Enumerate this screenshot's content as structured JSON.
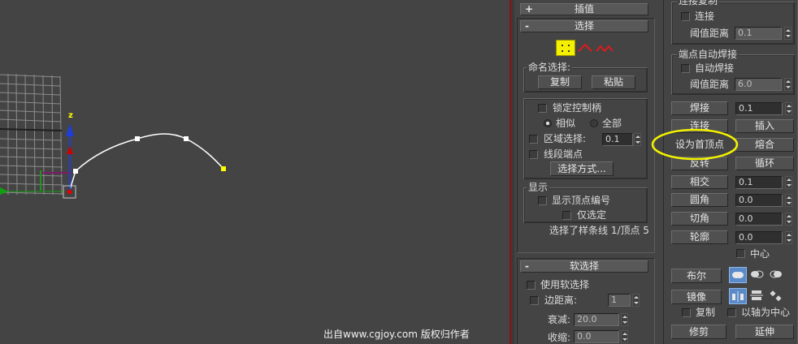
{
  "watermark": "出自www.cgjoy.com 版权归作者",
  "viewport": {
    "axis_z_label": "z"
  },
  "colors": {
    "viewport_bg": "#444444",
    "spline": "#ffffff",
    "vertex_selected": "#ffff00",
    "highlight_ellipse": "#f3f200",
    "accent_red": "#e00000",
    "active_icon": "#5a8ac8"
  },
  "interpolation": {
    "toggle": "+",
    "title": "插值"
  },
  "selection": {
    "toggle": "-",
    "title": "选择",
    "level_icons": [
      "vertex-level-icon",
      "segment-level-icon",
      "spline-level-icon"
    ],
    "named_group_label": "命名选择:",
    "copy_label": "复制",
    "paste_label": "粘贴",
    "lock_handles_label": "锁定控制柄",
    "similar_label": "相似",
    "all_label": "全部",
    "area_select_label": "区域选择:",
    "area_select_value": "0.1",
    "segment_end_label": "线段端点",
    "select_by_label": "选择方式...",
    "display_group_label": "显示",
    "show_vertex_numbers_label": "显示顶点编号",
    "selected_only_label": "仅选定",
    "status": "选择了样条线 1/顶点 5"
  },
  "soft_selection": {
    "toggle": "-",
    "title": "软选择",
    "use_soft_label": "使用软选择",
    "edge_distance_label": "边距离:",
    "edge_distance_value": "1",
    "falloff_label": "衰减:",
    "falloff_value": "20.0",
    "pinch_label": "收缩:",
    "pinch_value": "0.0"
  },
  "geometry": {
    "connect_copy_group_label": "连接复制",
    "connect_label": "连接",
    "threshold_label": "阈值距离",
    "threshold_value": "0.1",
    "end_weld_group_label": "端点自动焊接",
    "auto_weld_label": "自动焊接",
    "weld_threshold_value": "6.0",
    "weld_label": "焊接",
    "weld_value": "0.1",
    "connect_btn_label": "连接",
    "insert_label": "插入",
    "make_first_label": "设为首顶点",
    "fuse_label": "熔合",
    "reverse_label": "反转",
    "cycle_label": "循环",
    "cross_insert_label": "相交",
    "cross_insert_value": "0.1",
    "fillet_label": "圆角",
    "fillet_value": "0.0",
    "chamfer_label": "切角",
    "chamfer_value": "0.0",
    "outline_label": "轮廓",
    "outline_value": "0.0",
    "center_label": "中心",
    "boolean_label": "布尔",
    "boolean_icons": [
      "union-icon",
      "subtraction-icon",
      "intersection-icon"
    ],
    "mirror_label": "镜像",
    "mirror_icons": [
      "mirror-horizontal-icon",
      "mirror-vertical-icon",
      "mirror-both-icon"
    ],
    "copy_label": "复制",
    "about_pivot_label": "以轴为中心",
    "trim_label": "修剪",
    "extend_label": "延伸"
  }
}
